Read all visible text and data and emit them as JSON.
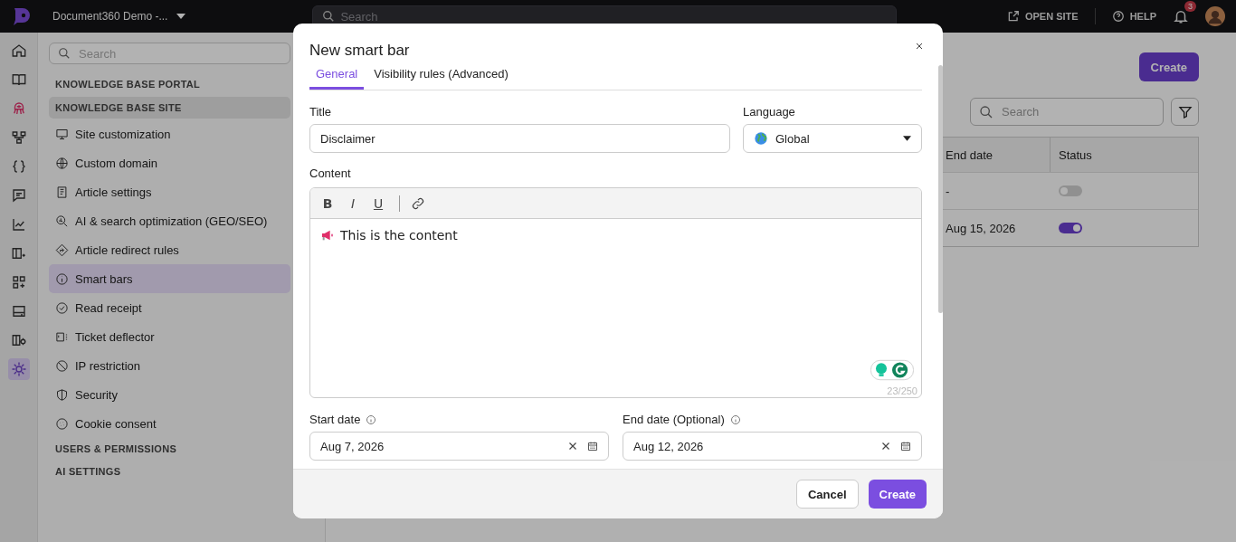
{
  "topbar": {
    "project": "Document360 Demo -...",
    "search_placeholder": "Search",
    "open_site": "OPEN SITE",
    "help": "HELP",
    "notifications": "3"
  },
  "rail": [
    {
      "selected": false
    },
    {
      "selected": false
    },
    {
      "selected": false
    },
    {
      "selected": false
    },
    {
      "selected": false
    },
    {
      "selected": false
    },
    {
      "selected": false
    },
    {
      "selected": false
    },
    {
      "selected": false
    },
    {
      "selected": false
    },
    {
      "selected": false
    },
    {
      "selected": true
    }
  ],
  "sidebar": {
    "search_placeholder": "Search",
    "groups": [
      {
        "title": "KNOWLEDGE BASE PORTAL",
        "expanded": false
      },
      {
        "title": "KNOWLEDGE BASE SITE",
        "expanded": true,
        "items": [
          {
            "label": "Site customization",
            "selected": false
          },
          {
            "label": "Custom domain",
            "selected": false
          },
          {
            "label": "Article settings",
            "selected": false
          },
          {
            "label": "AI & search optimization (GEO/SEO)",
            "selected": false
          },
          {
            "label": "Article redirect rules",
            "selected": false
          },
          {
            "label": "Smart bars",
            "selected": true
          },
          {
            "label": "Read receipt",
            "selected": false
          },
          {
            "label": "Ticket deflector",
            "selected": false
          },
          {
            "label": "IP restriction",
            "selected": false
          },
          {
            "label": "Security",
            "selected": false
          },
          {
            "label": "Cookie consent",
            "selected": false
          }
        ]
      },
      {
        "title": "USERS & PERMISSIONS",
        "expanded": false
      },
      {
        "title": "AI SETTINGS",
        "expanded": false
      }
    ]
  },
  "main": {
    "create": "Create",
    "search_placeholder": "Search",
    "table": {
      "columns": [
        "End date",
        "Status"
      ],
      "rows": [
        {
          "end_date": "-",
          "on": false
        },
        {
          "end_date": "Aug 15, 2026",
          "on": true
        }
      ]
    }
  },
  "modal": {
    "title": "New smart bar",
    "tabs": [
      {
        "label": "General",
        "selected": true
      },
      {
        "label": "Visibility rules (Advanced)",
        "selected": false
      }
    ],
    "title_label": "Title",
    "title_value": "Disclaimer",
    "language_label": "Language",
    "language_value": "Global",
    "content_label": "Content",
    "toolbar": [
      {
        "label": "B",
        "kind": "bold"
      },
      {
        "label": "I",
        "kind": "italic"
      },
      {
        "label": "U",
        "kind": "underline"
      }
    ],
    "content": "This is the content",
    "counter": "23/250",
    "start_label": "Start date",
    "start_value": "Aug 7, 2026",
    "end_label": "End date (Optional)",
    "end_value": "Aug 12, 2026",
    "buttons": [
      {
        "label": "Cancel",
        "kind": "secondary"
      },
      {
        "label": "Create",
        "kind": "primary"
      }
    ]
  }
}
